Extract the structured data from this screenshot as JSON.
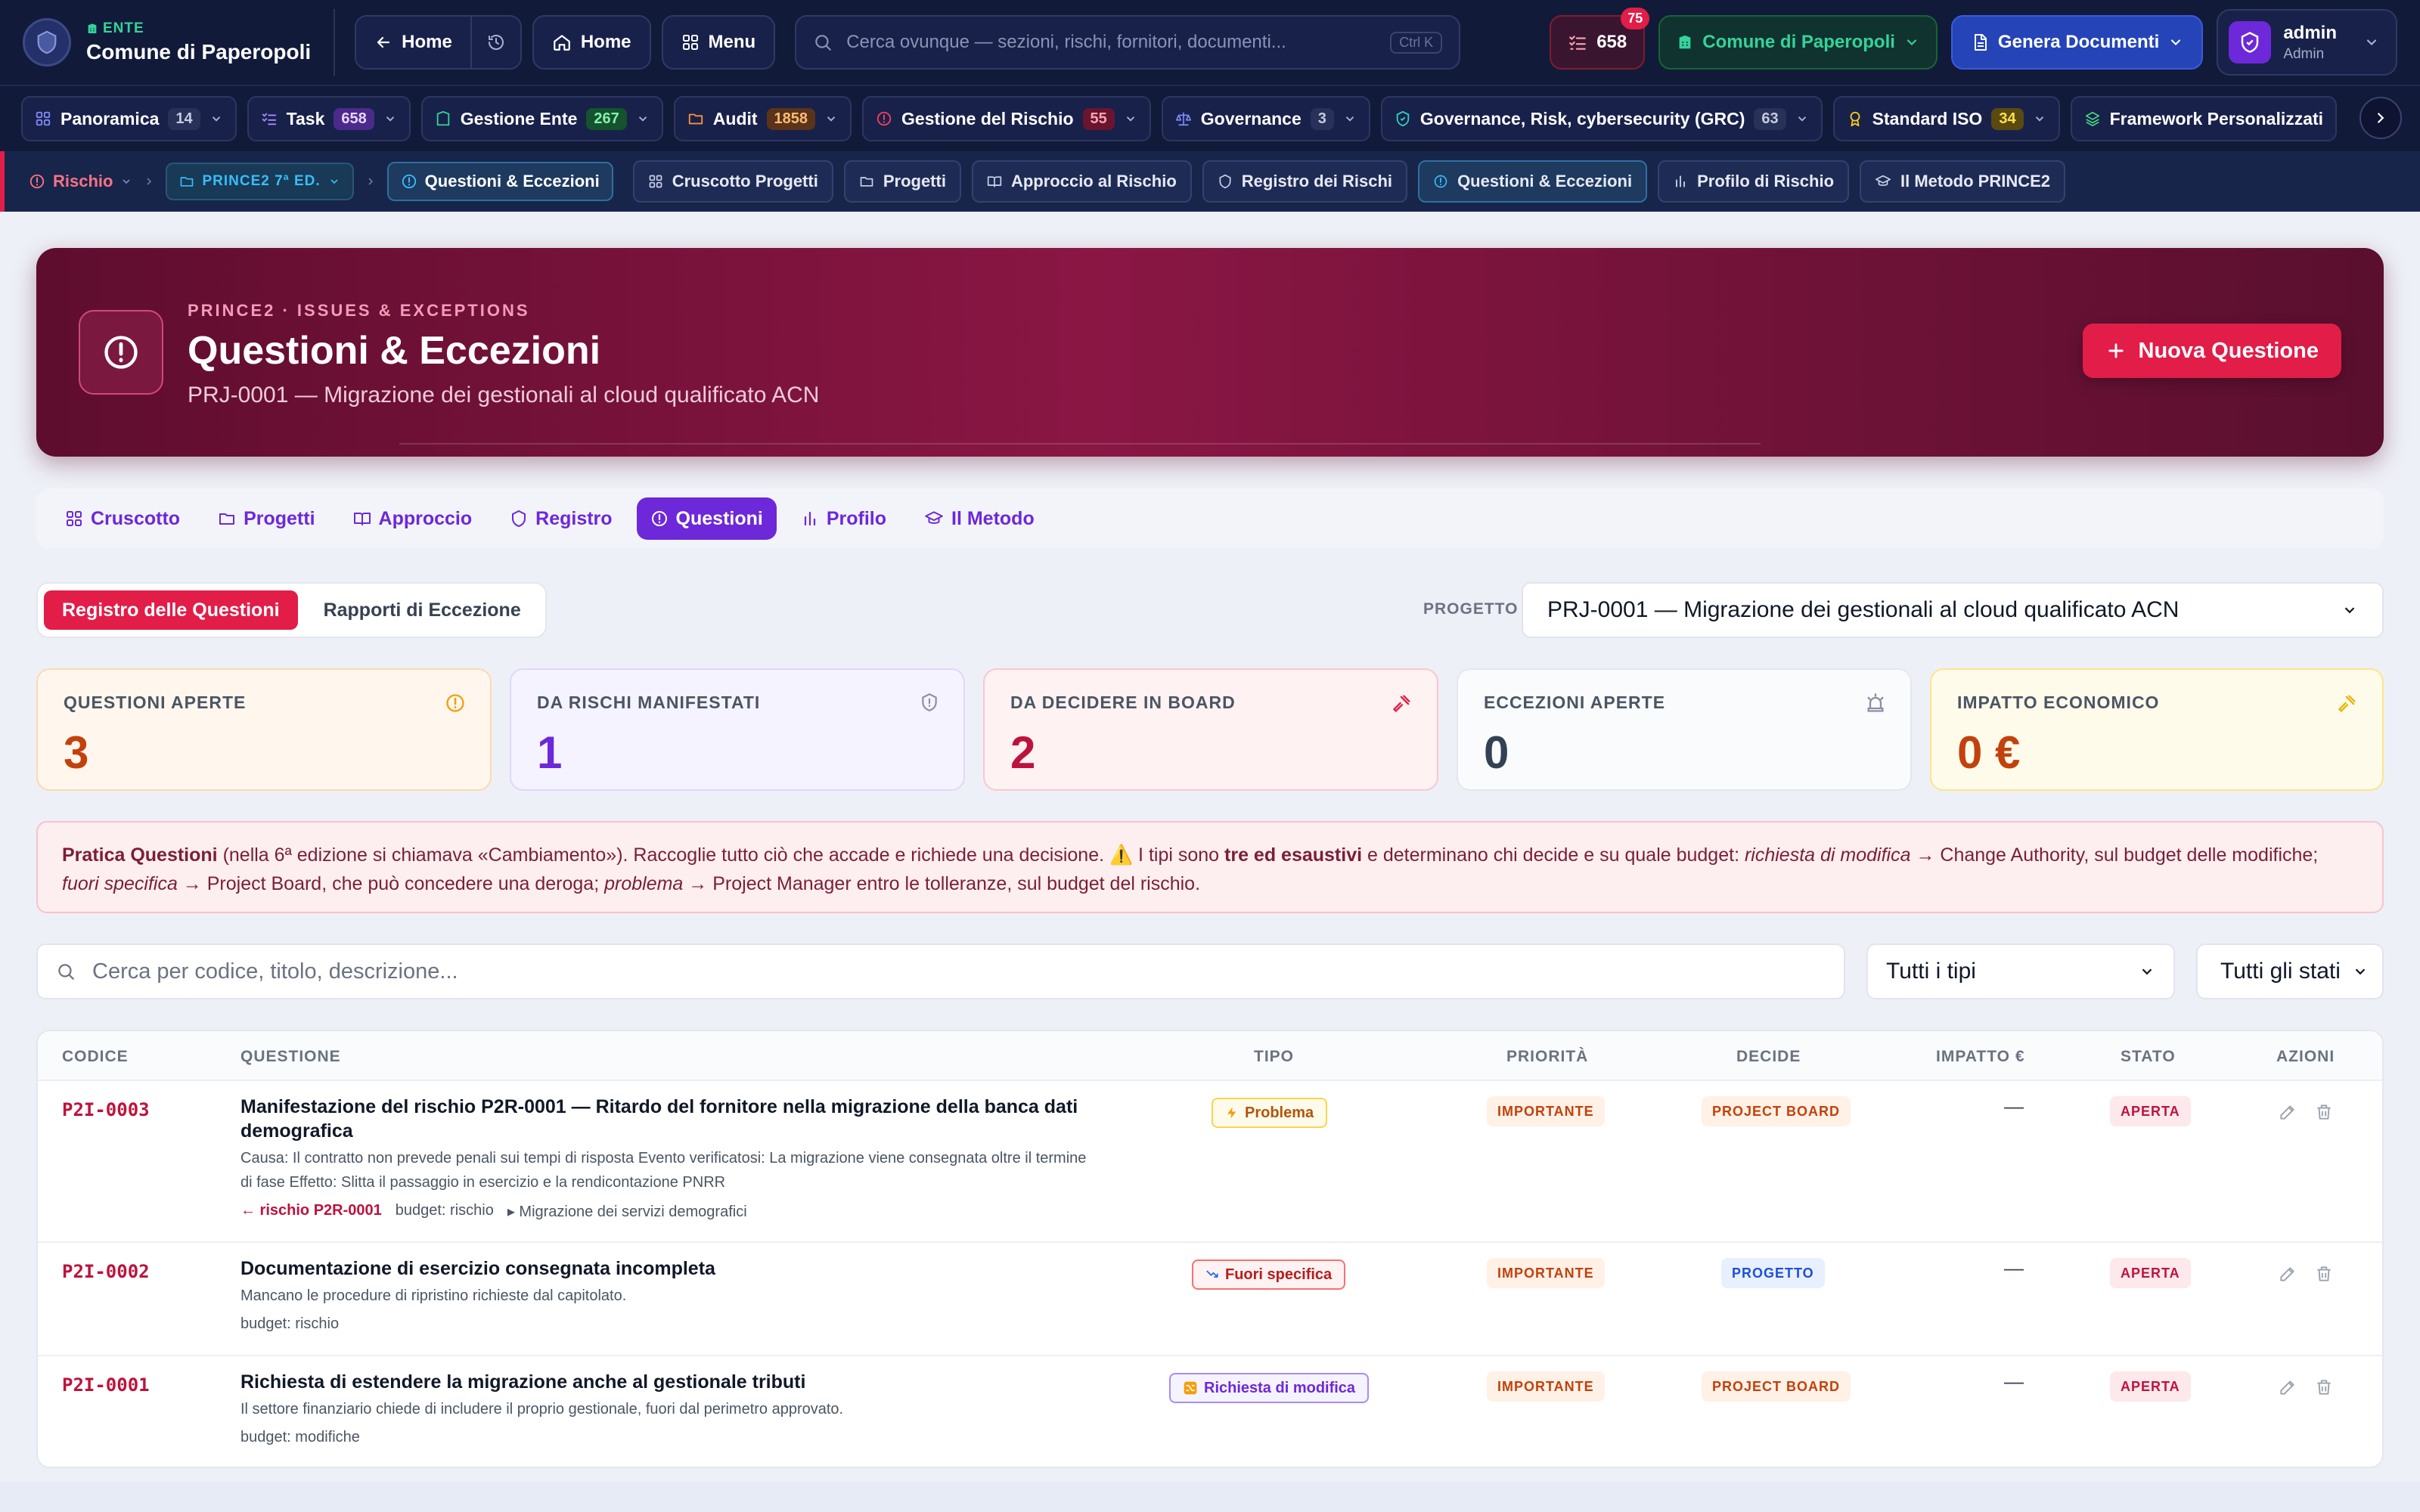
{
  "header": {
    "brand_kicker": "ENTE",
    "brand_name": "Comune di Paperopoli",
    "back_label": "Home",
    "home_label": "Home",
    "menu_label": "Menu",
    "search_placeholder": "Cerca ovunque — sezioni, rischi, fornitori, documenti...",
    "search_shortcut": "Ctrl K",
    "tasks_count": "658",
    "notifications_count": "75",
    "ente_select": "Comune di Paperopoli",
    "generate_label": "Genera Documenti",
    "user_name": "admin",
    "user_role": "Admin"
  },
  "modules": [
    {
      "label": "Panoramica",
      "count": "14"
    },
    {
      "label": "Task",
      "count": "658"
    },
    {
      "label": "Gestione Ente",
      "count": "267"
    },
    {
      "label": "Audit",
      "count": "1858"
    },
    {
      "label": "Gestione del Rischio",
      "count": "55"
    },
    {
      "label": "Governance",
      "count": "3"
    },
    {
      "label": "Governance, Risk, cybersecurity (GRC)",
      "count": "63"
    },
    {
      "label": "Standard ISO",
      "count": "34"
    },
    {
      "label": "Framework Personalizzati",
      "count": ""
    }
  ],
  "breadcrumb": {
    "root": "Rischio",
    "section": "PRINCE2 7ª ED.",
    "current": "Questioni & Eccezioni",
    "subnav": [
      "Cruscotto Progetti",
      "Progetti",
      "Approccio al Rischio",
      "Registro dei Rischi",
      "Questioni & Eccezioni",
      "Profilo di Rischio",
      "Il Metodo PRINCE2"
    ]
  },
  "hero": {
    "kicker": "PRINCE2 · ISSUES & EXCEPTIONS",
    "title": "Questioni & Eccezioni",
    "subtitle": "PRJ-0001 — Migrazione dei gestionali al cloud qualificato ACN",
    "new_button": "Nuova Questione"
  },
  "tabs": [
    "Cruscotto",
    "Progetti",
    "Approccio",
    "Registro",
    "Questioni",
    "Profilo",
    "Il Metodo"
  ],
  "subtabs": [
    "Registro delle Questioni",
    "Rapporti di Eccezione"
  ],
  "project": {
    "label": "PROGETTO",
    "value": "PRJ-0001 — Migrazione dei gestionali al cloud qualificato ACN"
  },
  "kpis": [
    {
      "label": "QUESTIONI APERTE",
      "value": "3"
    },
    {
      "label": "DA RISCHI MANIFESTATI",
      "value": "1"
    },
    {
      "label": "DA DECIDERE IN BOARD",
      "value": "2"
    },
    {
      "label": "ECCEZIONI APERTE",
      "value": "0"
    },
    {
      "label": "IMPATTO ECONOMICO",
      "value": "0 €"
    }
  ],
  "notice": {
    "b1": "Pratica Questioni",
    "t1": " (nella 6ª edizione si chiamava «Cambiamento»). Raccoglie tutto ciò che accade e richiede una decisione. ⚠️ I tipi sono ",
    "b2": "tre ed esaustivi",
    "t2": " e determinano chi decide e su quale budget: ",
    "i1": "richiesta di modifica",
    "t3": " → Change Authority, sul budget delle modifiche; ",
    "i2": "fuori specifica",
    "t4": " → Project Board, che può concedere una deroga; ",
    "i3": "problema",
    "t5": " → Project Manager entro le tolleranze, sul budget del rischio."
  },
  "filters": {
    "search_placeholder": "Cerca per codice, titolo, descrizione...",
    "type_select": "Tutti i tipi",
    "status_select": "Tutti gli stati"
  },
  "table": {
    "headers": [
      "CODICE",
      "QUESTIONE",
      "TIPO",
      "PRIORITÀ",
      "DECIDE",
      "IMPATTO €",
      "STATO",
      "AZIONI"
    ],
    "rows": [
      {
        "code": "P2I-0003",
        "title": "Manifestazione del rischio P2R-0001 — Ritardo del fornitore nella migrazione della banca dati demografica",
        "desc": "Causa: Il contratto non prevede penali sui tempi di risposta Evento verificatosi: La migrazione viene consegnata oltre il termine di fase Effetto: Slitta il passaggio in esercizio e la rendicontazione PNRR",
        "risk_link": "← rischio P2R-0001",
        "budget": "budget: rischio",
        "extra": "▸ Migrazione dei servizi demografici",
        "type": "Problema",
        "priority": "IMPORTANTE",
        "decider": "PROJECT BOARD",
        "impact": "—",
        "status": "APERTA"
      },
      {
        "code": "P2I-0002",
        "title": "Documentazione di esercizio consegnata incompleta",
        "desc": "Mancano le procedure di ripristino richieste dal capitolato.",
        "budget": "budget: rischio",
        "type": "Fuori specifica",
        "priority": "IMPORTANTE",
        "decider": "PROGETTO",
        "impact": "—",
        "status": "APERTA"
      },
      {
        "code": "P2I-0001",
        "title": "Richiesta di estendere la migrazione anche al gestionale tributi",
        "desc": "Il settore finanziario chiede di includere il proprio gestionale, fuori dal perimetro approvato.",
        "budget": "budget: modifiche",
        "type": "Richiesta di modifica",
        "priority": "IMPORTANTE",
        "decider": "PROJECT BOARD",
        "impact": "—",
        "status": "APERTA"
      }
    ]
  },
  "colors": {
    "accent": "#e11d48",
    "primary": "#6d28d9",
    "header_bg": "#121a3a",
    "hero_bg": "#8a1644"
  }
}
